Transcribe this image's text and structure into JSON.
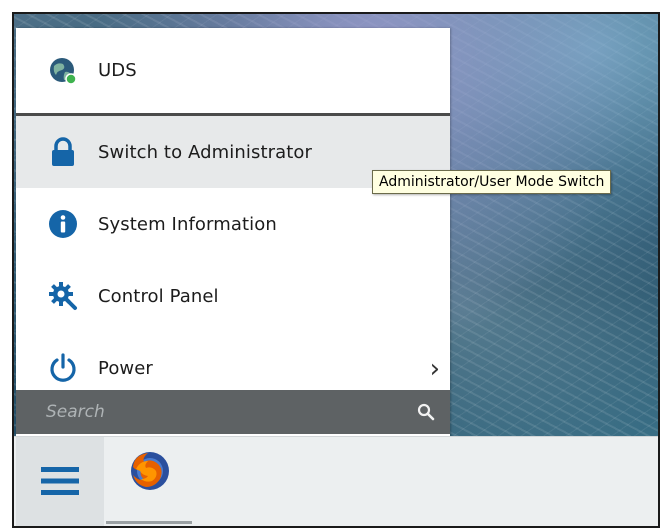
{
  "menu": {
    "items": [
      {
        "label": "UDS",
        "icon": "globe-user-icon"
      },
      {
        "label": "Switch to Administrator",
        "icon": "lock-icon"
      },
      {
        "label": "System Information",
        "icon": "info-icon"
      },
      {
        "label": "Control Panel",
        "icon": "gear-wrench-icon"
      },
      {
        "label": "Power",
        "icon": "power-icon",
        "submenu_icon": "chevron-right-icon"
      }
    ],
    "chevron": "›"
  },
  "search": {
    "placeholder": "Search",
    "icon": "search-icon"
  },
  "tooltip": {
    "text": "Administrator/User Mode Switch"
  },
  "taskbar": {
    "start_icon": "hamburger-menu-icon",
    "apps": [
      {
        "name": "firefox",
        "icon": "firefox-icon"
      }
    ]
  },
  "colors": {
    "accent_blue": "#1565a8",
    "menu_bg": "#ffffff",
    "active_item_bg": "#e7e9ea",
    "search_bg": "#5e6264",
    "tooltip_bg": "#ffffe1"
  }
}
